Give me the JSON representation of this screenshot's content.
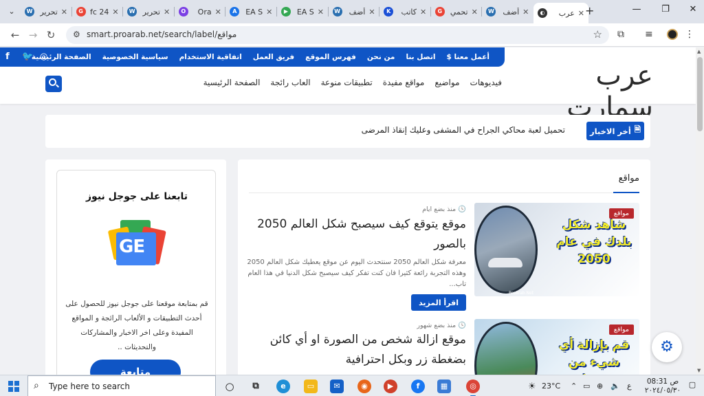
{
  "browser": {
    "tabs": [
      {
        "title": "تحرير",
        "icon": "W",
        "color": "#2a6fb0",
        "active": false
      },
      {
        "title": "fc 24",
        "icon": "G",
        "color": "#ea4335",
        "active": false
      },
      {
        "title": "تحرير",
        "icon": "W",
        "color": "#2a6fb0",
        "active": false
      },
      {
        "title": "Ora",
        "icon": "O",
        "color": "#7b3fe4",
        "active": false
      },
      {
        "title": "EA S",
        "icon": "A",
        "color": "#1a73e8",
        "active": false
      },
      {
        "title": "EA S",
        "icon": "▶",
        "color": "#34a853",
        "active": false
      },
      {
        "title": "أضف",
        "icon": "W",
        "color": "#2a6fb0",
        "active": false
      },
      {
        "title": "كاتب",
        "icon": "K",
        "color": "#1a4fd6",
        "active": false
      },
      {
        "title": "تحمي",
        "icon": "G",
        "color": "#ea4335",
        "active": false
      },
      {
        "title": "أضف",
        "icon": "W",
        "color": "#2a6fb0",
        "active": false
      },
      {
        "title": "عرب",
        "icon": "◐",
        "color": "#333333",
        "active": true
      }
    ],
    "url": "smart.proarab.net/search/label/مواقع"
  },
  "site": {
    "logo": "عرب سمارت",
    "top_links": [
      "الصفحة الرئيسية",
      "سياسية الخصوصية",
      "اتفاقية الاستخدام",
      "فريق العمل",
      "فهرس الموقع",
      "من نحن",
      "اتصل بنا",
      "أعمل معنا $"
    ],
    "nav": [
      "الصفحة الرئيسية",
      "العاب رائجة",
      "تطبيقات منوعة",
      "مواقع مفيدة",
      "مواضيع",
      "فيديوهات"
    ],
    "ticker": {
      "label": "أخر الاخبار",
      "text": "تحميل لعبة محاكي الجراح في المشفى وعليك إنقاذ المرضى"
    },
    "section_title": "مواقع",
    "posts": [
      {
        "category": "مواقع",
        "image_caption": "شاهد شكل بلدك في عام 2050",
        "image_tag": "ProArab.Net",
        "meta": "منذ بضع ايام",
        "title": "موقع يتوقع كيف سيصبح شكل العالم 2050 بالصور",
        "excerpt": "معرفة شكل العالم 2050 سنتحدث اليوم عن موقع يعطيك شكل العالم 2050 وهذه التجربة رائعة كثيرا فان كنت تفكر كيف سيصبح شكل الدنيا في هذا العام تاب...",
        "read_more": "اقرأ المزيد"
      },
      {
        "category": "مواقع",
        "image_caption": "قم بإزالة أي شيء من صورك",
        "meta": "منذ بضع شهور",
        "title": "موقع ازالة شخص من الصورة او أي كائن بضغطة زر وبكل احترافية"
      }
    ],
    "sidebar": {
      "title": "تابعنا على جوجل نيوز",
      "logo_text": "GE",
      "description": "قم بمتابعة موقعنا على جوجل نيوز للحصول على أحدث التطبيقات و الألعاب الرائجة و المواقع المفيدة وعلى اخر الاخبار والمشاركات والتحديثات ..",
      "button": "متابعة"
    }
  },
  "taskbar": {
    "search_placeholder": "Type here to search",
    "temperature": "23°C",
    "language": "ع",
    "time": "08:31 ص",
    "date": "٢٠٢٤/٠٥/٣٠"
  }
}
